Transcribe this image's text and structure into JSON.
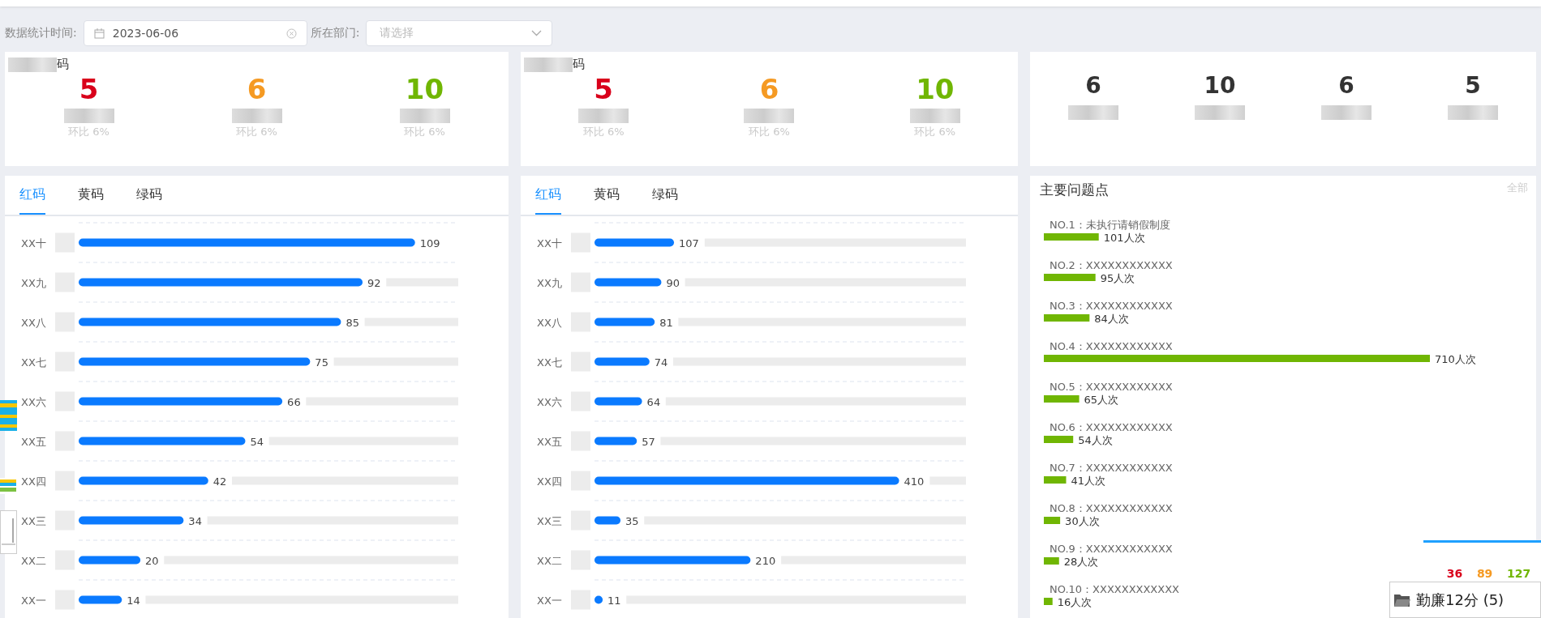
{
  "filters": [
    {
      "kind": "date",
      "label": "数据统计时间:",
      "value": "2023-06-06"
    },
    {
      "kind": "select",
      "label": "所在部门:",
      "placeholder": "请选择"
    }
  ],
  "summary_cards": [
    {
      "title": "码",
      "stats": [
        {
          "value": "5",
          "color": "#d9001b",
          "change": "环比 6%"
        },
        {
          "value": "6",
          "color": "#f59a23",
          "change": "环比 6%"
        },
        {
          "value": "10",
          "color": "#70b603",
          "change": "环比 6%"
        }
      ]
    },
    {
      "title": "码",
      "stats": [
        {
          "value": "5",
          "color": "#d9001b",
          "change": "环比 6%"
        },
        {
          "value": "6",
          "color": "#f59a23",
          "change": "环比 6%"
        },
        {
          "value": "10",
          "color": "#70b603",
          "change": "环比 6%"
        }
      ]
    },
    {
      "stats": [
        {
          "value": "6",
          "color": "#333333"
        },
        {
          "value": "10",
          "color": "#333333"
        },
        {
          "value": "6",
          "color": "#333333"
        },
        {
          "value": "5",
          "color": "#333333"
        }
      ]
    }
  ],
  "rank_panels": [
    {
      "tabs": [
        {
          "label": "红码",
          "selected": true
        },
        {
          "label": "黄码",
          "selected": false
        },
        {
          "label": "绿码",
          "selected": false
        }
      ],
      "chart_data": {
        "type": "bar",
        "orientation": "horizontal",
        "categories": [
          "XX十",
          "XX九",
          "XX八",
          "XX七",
          "XX六",
          "XX五",
          "XX四",
          "XX三",
          "XX二",
          "XX一"
        ],
        "values": [
          109,
          92,
          85,
          75,
          66,
          54,
          42,
          34,
          20,
          14
        ],
        "xlim": [
          0,
          123
        ],
        "data_labels": true,
        "grid": true
      }
    },
    {
      "tabs": [
        {
          "label": "红码",
          "selected": true
        },
        {
          "label": "黄码",
          "selected": false
        },
        {
          "label": "绿码",
          "selected": false
        }
      ],
      "chart_data": {
        "type": "bar",
        "orientation": "horizontal",
        "categories": [
          "XX十",
          "XX九",
          "XX八",
          "XX七",
          "XX六",
          "XX五",
          "XX四",
          "XX三",
          "XX二",
          "XX一"
        ],
        "values": [
          107,
          90,
          81,
          74,
          64,
          57,
          410,
          35,
          210,
          11
        ],
        "xlim": [
          0,
          500
        ],
        "data_labels": true,
        "grid": true
      }
    }
  ],
  "issues_panel": {
    "title": "主要问题点",
    "link": "全部",
    "chart_data": {
      "type": "bar",
      "orientation": "horizontal",
      "categories": [
        "NO.1：未执行请销假制度",
        "NO.2：XXXXXXXXXXXX",
        "NO.3：XXXXXXXXXXXX",
        "NO.4：XXXXXXXXXXXX",
        "NO.5：XXXXXXXXXXXX",
        "NO.6：XXXXXXXXXXXX",
        "NO.7：XXXXXXXXXXXX",
        "NO.8：XXXXXXXXXXXX",
        "NO.9：XXXXXXXXXXXX",
        "NO.10：XXXXXXXXXXXX"
      ],
      "values": [
        101,
        95,
        84,
        710,
        65,
        54,
        41,
        30,
        28,
        16
      ],
      "value_labels": [
        "101人次",
        "95人次",
        "84人次",
        "710人次",
        "65人次",
        "54人次",
        "41人次",
        "30人次",
        "28人次",
        "16人次"
      ],
      "xlim": [
        0,
        710
      ]
    }
  },
  "taskbar_preview": {
    "label": "勤廉12分 (5)",
    "thumbnail_numbers": [
      {
        "text": "36",
        "color": "#d9001b"
      },
      {
        "text": "89",
        "color": "#f59a23"
      },
      {
        "text": "127",
        "color": "#70b603"
      }
    ]
  }
}
